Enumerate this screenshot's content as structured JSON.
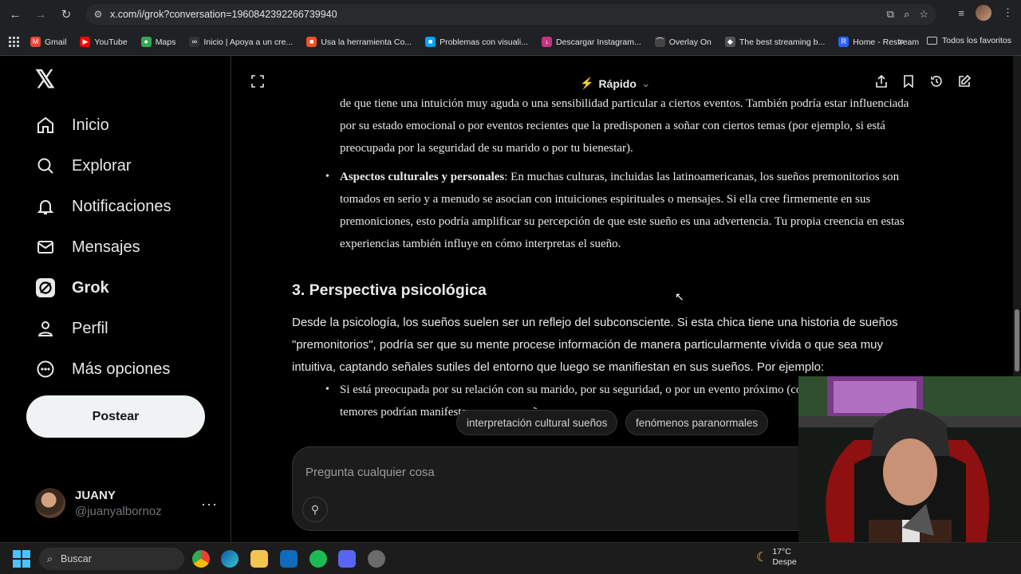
{
  "browser": {
    "url": "x.com/i/grok?conversation=1960842392266739940",
    "bookmarks": [
      {
        "label": "Gmail",
        "color": "#ea4335",
        "glyph": "M"
      },
      {
        "label": "YouTube",
        "color": "#ff0000",
        "glyph": "▶"
      },
      {
        "label": "Maps",
        "color": "#34a853",
        "glyph": "●"
      },
      {
        "label": "Inicio | Apoya a un cre...",
        "color": "#333",
        "glyph": "∞"
      },
      {
        "label": "Usa la herramienta Co...",
        "color": "#f25022",
        "glyph": "■"
      },
      {
        "label": "Problemas con visuali...",
        "color": "#00a4ef",
        "glyph": "■"
      },
      {
        "label": "Descargar Instagram...",
        "color": "#c13584",
        "glyph": "↓"
      },
      {
        "label": "Overlay On",
        "color": "#444",
        "glyph": "⌒"
      },
      {
        "label": "The best streaming b...",
        "color": "#555",
        "glyph": "◆"
      },
      {
        "label": "Home - Restream",
        "color": "#2962ff",
        "glyph": "R"
      }
    ],
    "all_bookmarks": "Todos los favoritos"
  },
  "sidebar": {
    "items": [
      {
        "label": "Inicio",
        "icon": "home-icon"
      },
      {
        "label": "Explorar",
        "icon": "search-icon"
      },
      {
        "label": "Notificaciones",
        "icon": "bell-icon"
      },
      {
        "label": "Mensajes",
        "icon": "mail-icon"
      },
      {
        "label": "Grok",
        "icon": "grok-icon"
      },
      {
        "label": "Perfil",
        "icon": "person-icon"
      },
      {
        "label": "Más opciones",
        "icon": "more-circle-icon"
      }
    ],
    "post_button": "Postear",
    "user": {
      "name": "JUANY",
      "handle": "@juanyalbornoz"
    }
  },
  "grok": {
    "mode": "Rápido",
    "bullet1_cont": "de que tiene una intuición muy aguda o una sensibilidad particular a ciertos eventos. También podría estar influenciada por su estado emocional o por eventos recientes que la predisponen a soñar con ciertos temas (por ejemplo, si está preocupada por la seguridad de su marido o por tu bienestar).",
    "bullet2_title": "Aspectos culturales y personales",
    "bullet2_text": ": En muchas culturas, incluidas las latinoamericanas, los sueños premonitorios son tomados en serio y a menudo se asocian con intuiciones espirituales o mensajes. Si ella cree firmemente en sus premoniciones, esto podría amplificar su percepción de que este sueño es una advertencia. Tu propia creencia en estas experiencias también influye en cómo interpretas el sueño.",
    "section_title": "3. Perspectiva psicológica",
    "section_para": "Desde la psicología, los sueños suelen ser un reflejo del subconsciente. Si esta chica tiene una historia de sueños \"premonitorios\", podría ser que su mente procese información de manera particularmente vívida o que sea muy intuitiva, captando señales sutiles del entorno que luego se manifiestan en sus sueños. Por ejemplo:",
    "bullet3_text": "Si está preocupada por su relación con su marido, por su seguridad, o por un evento próximo (como un viaje), esos temores podrían manifestarse en sus sueños como",
    "suggestions": [
      "interpretación cultural sueños",
      "fenómenos paranormales"
    ],
    "composer_placeholder": "Pregunta cualquier cosa"
  },
  "taskbar": {
    "search_placeholder": "Buscar",
    "weather_temp": "17°C",
    "weather_text": "Despe"
  }
}
